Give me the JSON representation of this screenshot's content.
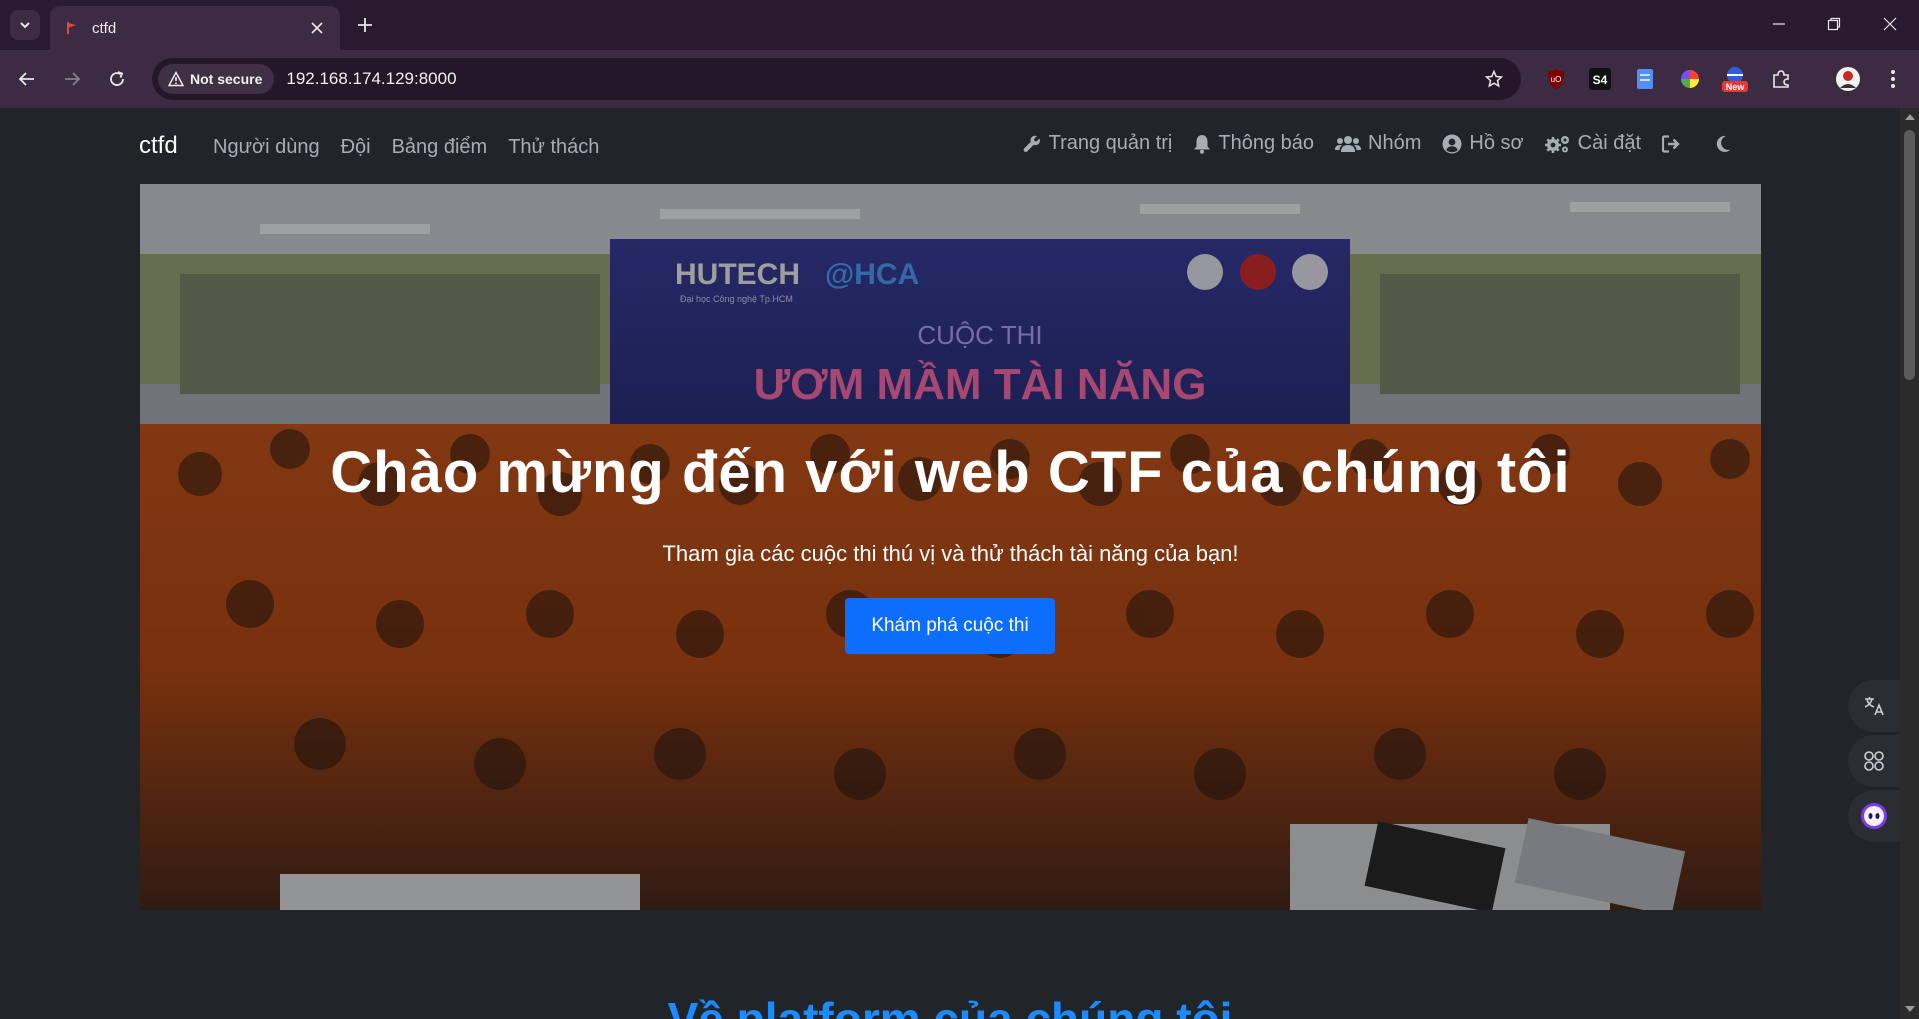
{
  "browser": {
    "tab_title": "ctfd",
    "security_label": "Not secure",
    "url": "192.168.174.129:8000",
    "extension_badge": "New"
  },
  "site": {
    "brand": "ctfd",
    "nav_left": [
      "Người dùng",
      "Đội",
      "Bảng điểm",
      "Thử thách"
    ],
    "nav_right": {
      "admin": "Trang quản trị",
      "notifications": "Thông báo",
      "teams": "Nhóm",
      "profile": "Hồ sơ",
      "settings": "Cài đặt"
    }
  },
  "hero": {
    "banner_school": "HUTECH",
    "banner_school_sub": "Đại học Công nghệ Tp.HCM",
    "banner_partner": "@HCA",
    "banner_event_line1": "CUỘC THI",
    "banner_event_line2": "ƯƠM MẦM TÀI NĂNG",
    "title": "Chào mừng đến với web CTF của chúng tôi",
    "subtitle": "Tham gia các cuộc thi thú vị và thử thách tài năng của bạn!",
    "cta": "Khám phá cuộc thi"
  },
  "about": {
    "title": "Về platform của chúng tôi"
  },
  "colors": {
    "primary": "#0d6efd",
    "section_title": "#1a8cff",
    "page_bg": "#212529",
    "chrome_bg": "#3c2b43"
  }
}
